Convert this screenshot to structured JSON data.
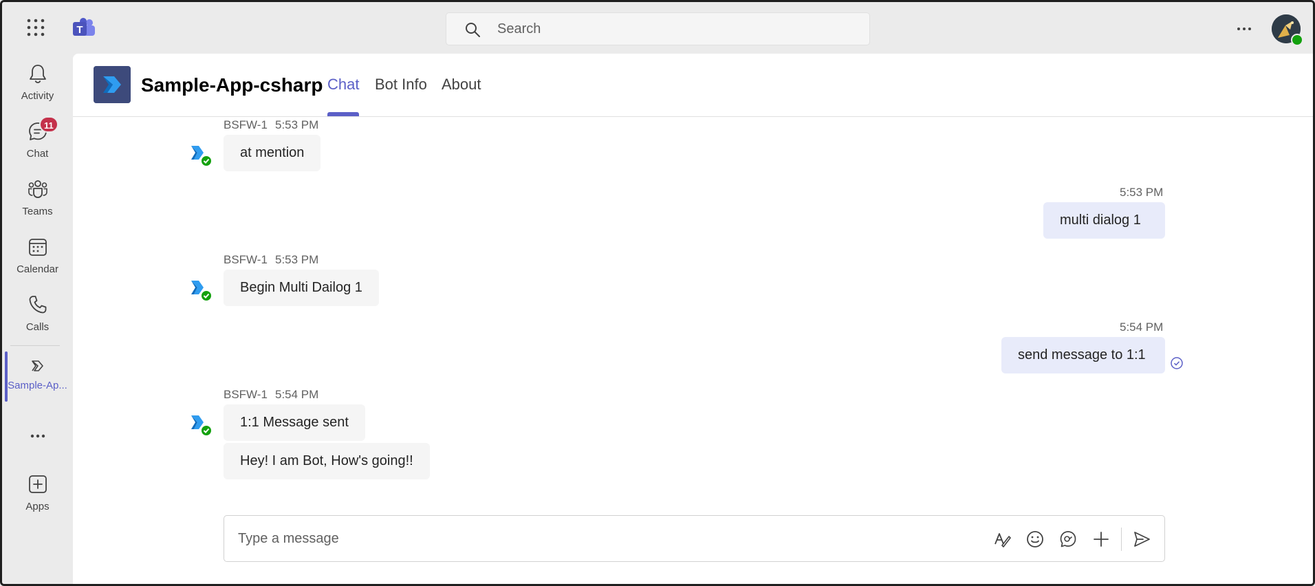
{
  "topbar": {
    "search_placeholder": "Search",
    "app_icon": "teams-logo",
    "avatar_status": "available"
  },
  "rail": {
    "items": [
      {
        "label": "Activity",
        "icon": "bell-icon"
      },
      {
        "label": "Chat",
        "icon": "chat-icon",
        "badge": "11"
      },
      {
        "label": "Teams",
        "icon": "teams-icon"
      },
      {
        "label": "Calendar",
        "icon": "calendar-icon"
      },
      {
        "label": "Calls",
        "icon": "phone-icon"
      },
      {
        "label": "Sample-Ap...",
        "icon": "sample-app-icon",
        "active": true
      },
      {
        "label": "",
        "icon": "more-icon"
      },
      {
        "label": "Apps",
        "icon": "add-app-icon"
      }
    ]
  },
  "header": {
    "app_title": "Sample-App-csharp",
    "tabs": [
      {
        "label": "Chat",
        "active": true
      },
      {
        "label": "Bot Info"
      },
      {
        "label": "About"
      }
    ]
  },
  "messages": [
    {
      "from": "bot",
      "sender": "BSFW-1",
      "time": "5:53 PM",
      "texts": [
        "at mention"
      ]
    },
    {
      "from": "me",
      "time": "5:53 PM",
      "texts": [
        "multi dialog 1"
      ]
    },
    {
      "from": "bot",
      "sender": "BSFW-1",
      "time": "5:53 PM",
      "texts": [
        "Begin Multi Dailog 1"
      ]
    },
    {
      "from": "me",
      "time": "5:54 PM",
      "texts": [
        "send message to 1:1"
      ],
      "read_receipt": "seen"
    },
    {
      "from": "bot",
      "sender": "BSFW-1",
      "time": "5:54 PM",
      "texts": [
        "1:1 Message sent",
        "Hey! I am Bot, How's going!!"
      ]
    }
  ],
  "composer": {
    "placeholder": "Type a message",
    "icons": [
      "format-icon",
      "emoji-icon",
      "loop-icon",
      "attach-plus-icon",
      "send-icon"
    ]
  },
  "colors": {
    "accent": "#5b5fc7",
    "badge": "#c4314b",
    "status_available": "#13a10e",
    "my_bubble": "#e8ebfa",
    "bot_bubble": "#f5f5f5"
  }
}
